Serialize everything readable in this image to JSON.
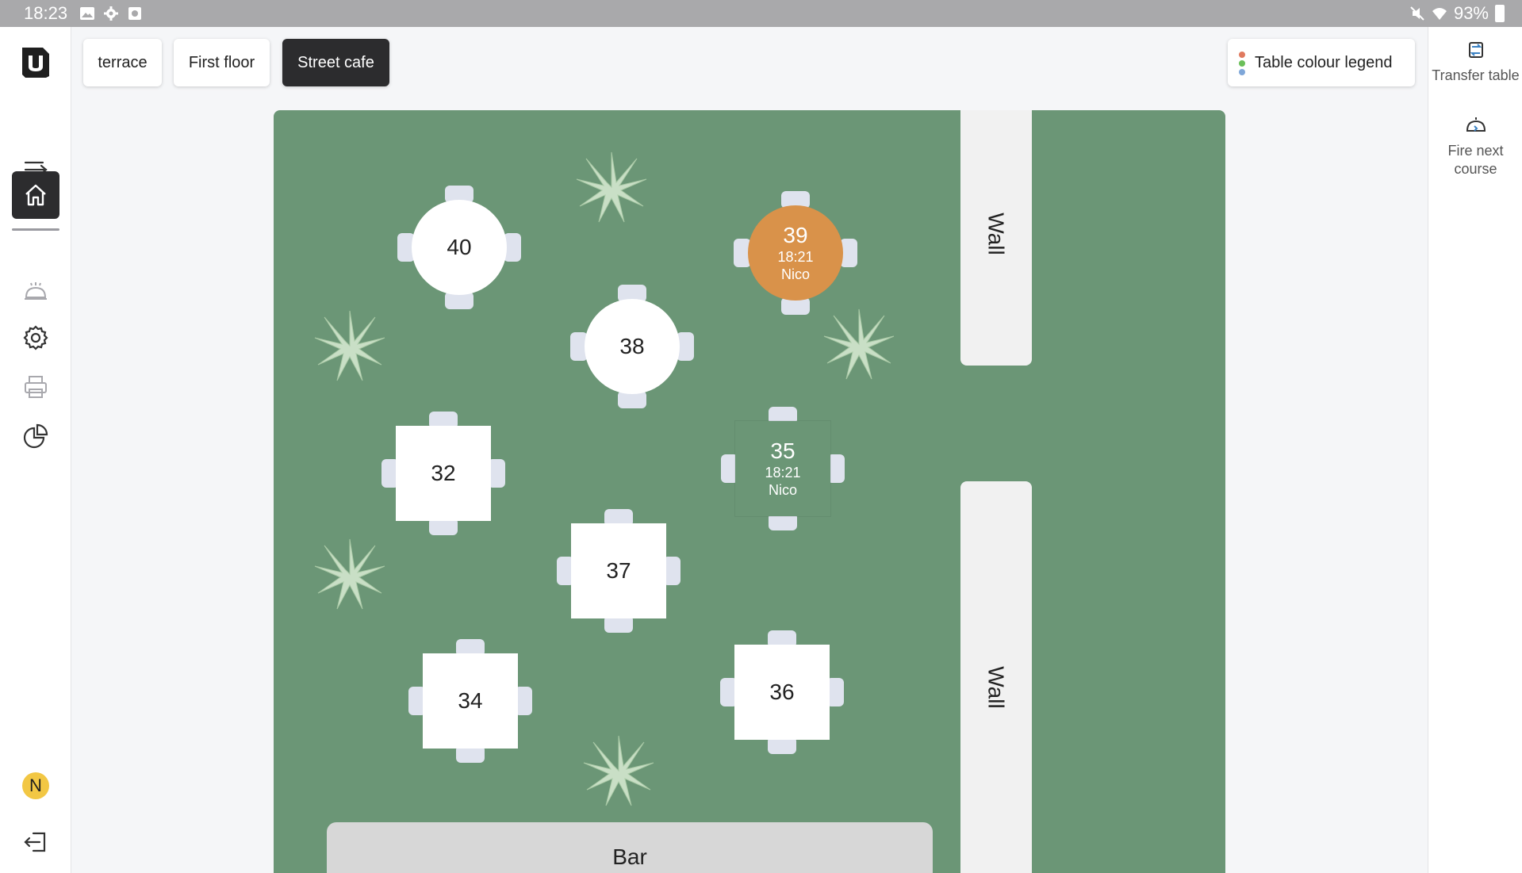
{
  "status_bar": {
    "time": "18:23",
    "battery": "93%"
  },
  "nav": {
    "items": [
      {
        "name": "expand-menu-icon"
      },
      {
        "name": "home-icon",
        "active": true
      },
      {
        "name": "kitchen-bell-icon"
      },
      {
        "name": "settings-gear-icon"
      },
      {
        "name": "printer-icon"
      },
      {
        "name": "reports-pie-icon"
      }
    ],
    "user_initial": "N"
  },
  "tabs": [
    {
      "label": "terrace",
      "active": false
    },
    {
      "label": "First floor",
      "active": false
    },
    {
      "label": "Street cafe",
      "active": true
    }
  ],
  "legend": {
    "label": "Table colour legend",
    "dot_colors": [
      "#e07a5f",
      "#6bbf59",
      "#7fa7d9"
    ]
  },
  "actions": {
    "transfer": "Transfer table",
    "fire_line1": "Fire next",
    "fire_line2": "course"
  },
  "floor": {
    "wall_top": "Wall",
    "wall_bottom": "Wall",
    "bar": "Bar",
    "tables": {
      "t40": {
        "number": "40"
      },
      "t39": {
        "number": "39",
        "time": "18:21",
        "waiter": "Nico",
        "status_color": "#d9924a"
      },
      "t38": {
        "number": "38"
      },
      "t32": {
        "number": "32"
      },
      "t35": {
        "number": "35",
        "time": "18:21",
        "waiter": "Nico"
      },
      "t37": {
        "number": "37"
      },
      "t34": {
        "number": "34"
      },
      "t36": {
        "number": "36"
      }
    }
  },
  "colors": {
    "floor": "#6b9676",
    "chair": "#dfe3ee",
    "accent_dark": "#2c2c2e"
  }
}
